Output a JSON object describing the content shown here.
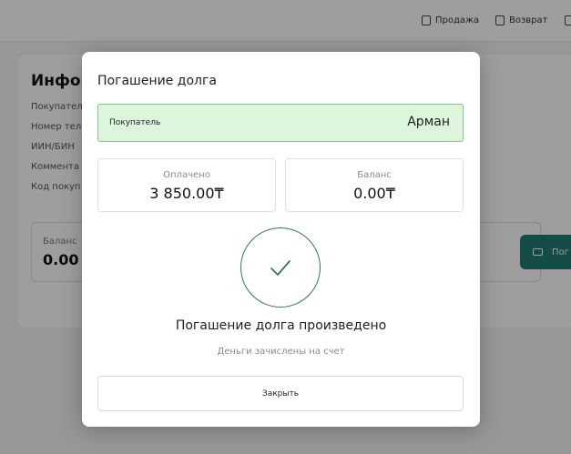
{
  "header": {
    "nav": [
      {
        "label": "Продажа",
        "icon": "bag-icon"
      },
      {
        "label": "Возврат",
        "icon": "return-bag-icon"
      }
    ]
  },
  "background": {
    "title": "Инфор",
    "fields": [
      "Покупател",
      "Номер тел",
      "ИИН/БИН",
      "Коммента",
      "Код покуп"
    ],
    "balance_label": "Баланс",
    "balance_value": "0.00",
    "pay_button_label": "Пог"
  },
  "modal": {
    "title": "Погашение долга",
    "buyer_label": "Покупатель",
    "buyer_value": "Арман",
    "paid_label": "Оплачено",
    "paid_value": "3 850.00₸",
    "balance_label": "Баланс",
    "balance_value": "0.00₸",
    "success_title": "Погашение долга произведено",
    "success_subtitle": "Деньги зачислены на счет",
    "close_label": "Закрыть"
  },
  "colors": {
    "accent": "#1f7a73",
    "success": "#2f7d4a",
    "buyer_bg": "#dcf5dc"
  }
}
